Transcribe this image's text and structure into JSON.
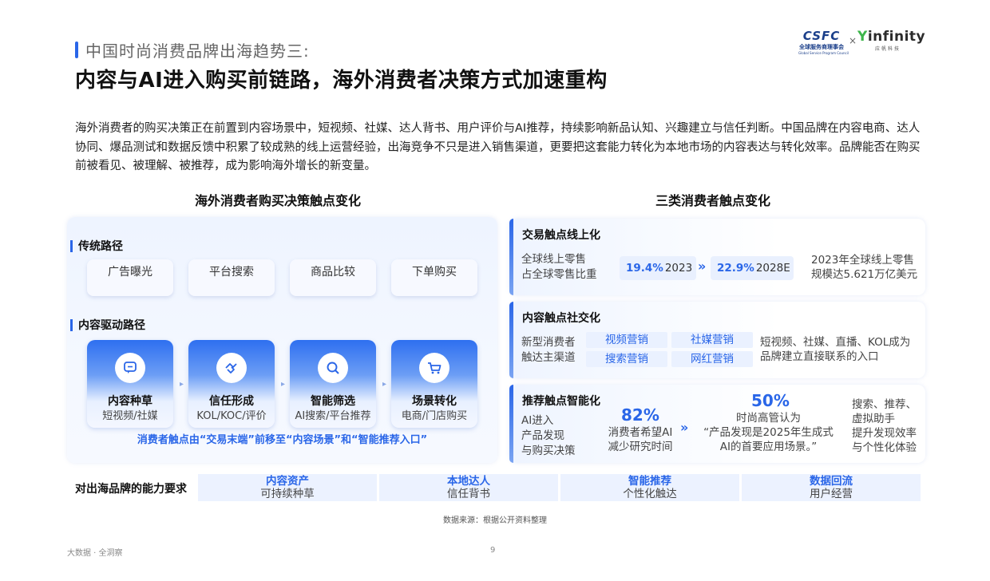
{
  "header": {
    "kicker": "中国时尚消费品牌出海趋势三:",
    "title": "内容与AI进入购买前链路，海外消费者决策方式加速重构"
  },
  "logos": {
    "csfc_mark": "CSFC",
    "csfc_cn": "全球服务商理事会",
    "csfc_en": "Global Service Program Council",
    "cross": "×",
    "infinity_mark": "infinity",
    "infinity_cn": "应帆科技"
  },
  "intro": "海外消费者的购买决策正在前置到内容场景中，短视频、社媒、达人背书、用户评价与AI推荐，持续影响新品认知、兴趣建立与信任判断。中国品牌在内容电商、达人协同、爆品测试和数据反馈中积累了较成熟的线上运营经验，出海竞争不只是进入销售渠道，更要把这套能力转化为本地市场的内容表达与转化效率。品牌能否在购买前被看见、被理解、被推荐，成为影响海外增长的新变量。",
  "left": {
    "section_title": "海外消费者购买决策触点变化",
    "traditional_label": "传统路径",
    "traditional_steps": [
      "广告曝光",
      "平台搜索",
      "商品比较",
      "下单购买"
    ],
    "content_label": "内容驱动路径",
    "content_steps": [
      {
        "title": "内容种草",
        "sub": "短视频/社媒",
        "icon": "chat-icon"
      },
      {
        "title": "信任形成",
        "sub": "KOL/KOC/评价",
        "icon": "handshake-icon"
      },
      {
        "title": "智能筛选",
        "sub": "AI搜索/平台推荐",
        "icon": "search-icon"
      },
      {
        "title": "场景转化",
        "sub": "电商/门店购买",
        "icon": "cart-icon"
      }
    ],
    "caption": "消费者触点由“交易末端”前移至“内容场景”和“智能推荐入口”"
  },
  "right": {
    "section_title": "三类消费者触点变化",
    "card1": {
      "title": "交易触点线上化",
      "label_line1": "全球线上零售",
      "label_line2": "占全球零售比重",
      "stat1_value": "19.4%",
      "stat1_year": "2023",
      "stat2_value": "22.9%",
      "stat2_year": "2028E",
      "note_line1": "2023年全球线上零售",
      "note_line2": "规模达5.621万亿美元"
    },
    "card2": {
      "title": "内容触点社交化",
      "label_line1": "新型消费者",
      "label_line2": "触达主渠道",
      "tags": [
        "视频营销",
        "社媒营销",
        "搜索营销",
        "网红营销"
      ],
      "note_line1": "短视频、社媒、直播、KOL成为",
      "note_line2": "品牌建立直接联系的入口"
    },
    "card3": {
      "title": "推荐触点智能化",
      "label_line1": "AI进入",
      "label_line2": "产品发现",
      "label_line3": "与购买决策",
      "stat1_value": "82%",
      "stat1_desc_line1": "消费者希望AI",
      "stat1_desc_line2": "减少研究时间",
      "stat2_value": "50%",
      "stat2_desc_line1": "时尚高管认为",
      "stat2_desc_line2": "“产品发现是2025年生成式",
      "stat2_desc_line3": "AI的首要应用场景。”",
      "note_line1": "搜索、推荐、",
      "note_line2": "虚拟助手",
      "note_line3": "提升发现效率",
      "note_line4": "与个性化体验"
    }
  },
  "capabilities": {
    "label": "对出海品牌的能力要求",
    "items": [
      {
        "title": "内容资产",
        "sub": "可持续种草"
      },
      {
        "title": "本地达人",
        "sub": "信任背书"
      },
      {
        "title": "智能推荐",
        "sub": "个性化触达"
      },
      {
        "title": "数据回流",
        "sub": "用户经营"
      }
    ]
  },
  "footer": {
    "source": "数据来源：根据公开资料整理",
    "left": "大数据 · 全洞察",
    "page": "9"
  },
  "colors": {
    "accent": "#2a66e8",
    "text": "#222222",
    "panel": "#eef4ff"
  }
}
